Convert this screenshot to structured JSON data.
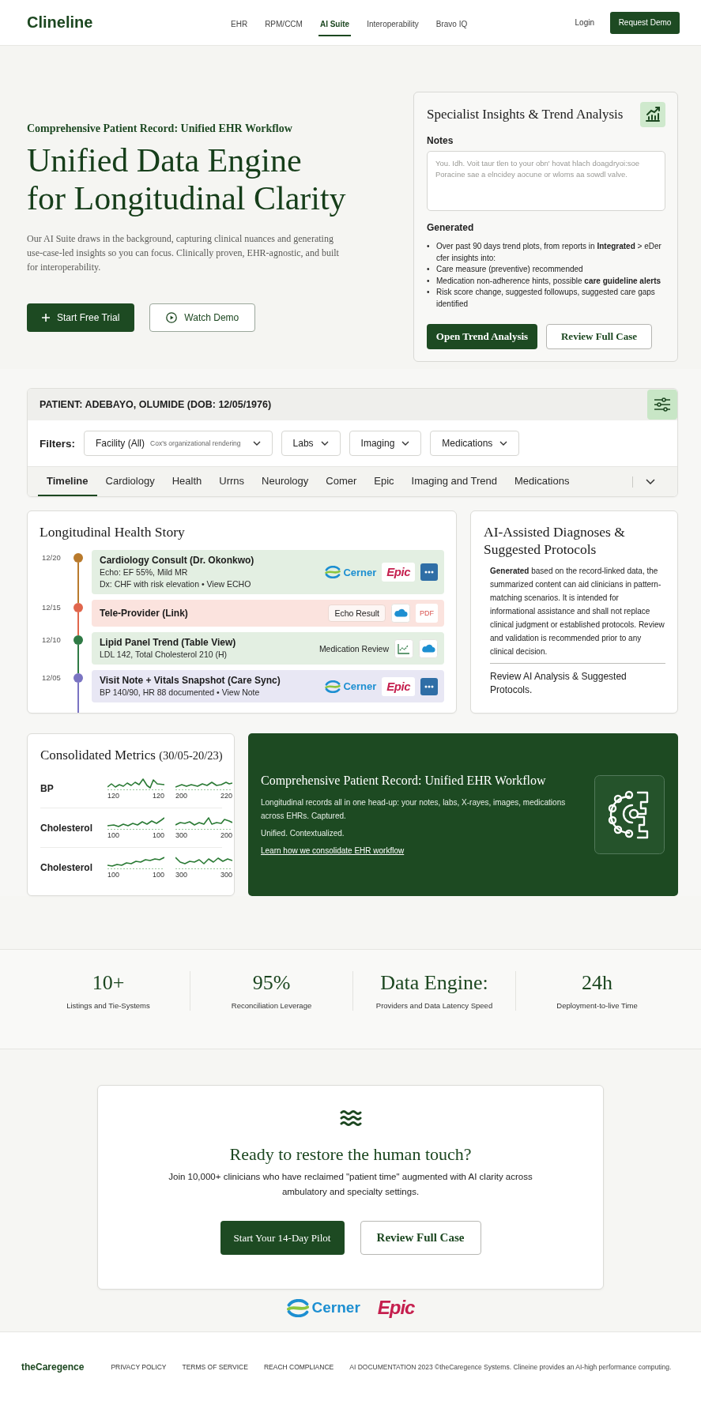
{
  "header": {
    "logo": "Clineline",
    "nav": [
      {
        "label": "EHR",
        "selected": false
      },
      {
        "label": "RPM/CCM",
        "selected": false
      },
      {
        "label": "AI Suite",
        "selected": true
      },
      {
        "label": "Interoperability",
        "selected": false
      },
      {
        "label": "Bravo IQ",
        "selected": false
      }
    ],
    "login": "Login",
    "request_demo": "Request Demo"
  },
  "hero": {
    "eyebrow": "Comprehensive Patient Record: Unified EHR Workflow",
    "headline_lines": [
      "Unified Data Engine",
      "for Longitudinal Clarity"
    ],
    "description": "Our AI Suite draws in the background, capturing clinical nuances and generating use-case-led insights so you can focus. Clinically proven, EHR-agnostic, and built for interoperability.",
    "buttons": [
      {
        "label": "Start Free Trial",
        "kind": "primary"
      },
      {
        "label": "Watch Demo",
        "kind": "secondary"
      }
    ]
  },
  "insights_card": {
    "title": "Specialist Insights & Trend Analysis",
    "notes": {
      "label": "Notes",
      "placeholder": "You. Idh. Voit taur tlen to your obn' hovat hlach doagdryoi:soe Poracine sae a elncidey aocune or wloms aa sowdl valve."
    },
    "generated_label": "Generated",
    "bullets": [
      {
        "marker": "•",
        "text": "Over past 90 days trend plots, from reports in **Integrated** > eDer cfer insights into:"
      },
      {
        "marker": "•",
        "text": "Care measure (preventive) recommended"
      },
      {
        "marker": "•",
        "text": "Medication non-adherence hints, possible **care guideline alerts**"
      },
      {
        "marker": "•",
        "text": "Risk score change, suggested followups, suggested care gaps identified"
      }
    ],
    "buttons": [
      {
        "label": "Open Trend Analysis",
        "kind": "primary"
      },
      {
        "label": "Review Full Case",
        "kind": "secondary"
      }
    ]
  },
  "patient_panel": {
    "title": "PATIENT: ADEBAYO, OLUMIDE (DOB: 12/05/1976)",
    "filters_label": "Filters:",
    "filters": [
      {
        "label": "Facility (All)",
        "note": "Cox's organizational rendering"
      },
      {
        "label": "Labs"
      },
      {
        "label": "Imaging"
      },
      {
        "label": "Medications"
      }
    ],
    "tabs": [
      {
        "label": "Timeline",
        "selected": true
      },
      {
        "label": "Cardiology",
        "selected": false
      },
      {
        "label": "Health",
        "selected": false
      },
      {
        "label": "Urrns",
        "selected": false
      },
      {
        "label": "Neurology",
        "selected": false
      },
      {
        "label": "Comer",
        "selected": false
      },
      {
        "label": "Epic",
        "selected": false
      },
      {
        "label": "Imaging and Trend",
        "selected": false
      },
      {
        "label": "Medications",
        "selected": false
      }
    ]
  },
  "timeline_card": {
    "title": "Longitudinal Health Story",
    "entries": [
      {
        "date": "12/20",
        "color": "#b97a2c",
        "card": {
          "color": "#e3efe2"
        },
        "title": "Cardiology Consult (Dr. Okonkwo)",
        "details": [
          "Echo: EF 55%, Mild MR",
          "Dx: CHF with risk elevation • View ECHO"
        ],
        "actions": [
          {
            "kind": "cerner_logo",
            "text": "Cerner"
          },
          {
            "kind": "epic_logo",
            "text": "Epic"
          },
          {
            "kind": "more_button"
          }
        ]
      },
      {
        "date": "12/15",
        "color": "#e0664c",
        "card": {
          "color": "#fbe3de"
        },
        "title": "Tele-Provider (Link)",
        "actions": [
          {
            "kind": "chip",
            "text": "Echo Result"
          },
          {
            "kind": "cloud_icon"
          },
          {
            "kind": "pdf_tag",
            "text": "PDF"
          }
        ]
      },
      {
        "date": "12/10",
        "color": "#2f7a45",
        "card": {
          "color": "#e3efe2"
        },
        "title": "Lipid Panel Trend (Table View)",
        "details": [
          "LDL 142, Total Cholesterol 210 (H)"
        ],
        "actions": [
          {
            "kind": "text",
            "text": "Medication Review"
          },
          {
            "kind": "chart_icon"
          },
          {
            "kind": "cloud_icon"
          }
        ]
      },
      {
        "date": "12/05",
        "color": "#7a74c2",
        "card": {
          "color": "#e8e7f4"
        },
        "title": "Visit Note + Vitals Snapshot (Care Sync)",
        "details": [
          "BP 140/90, HR 88 documented • View Note"
        ],
        "actions": [
          {
            "kind": "cerner_logo",
            "text": "Cerner"
          },
          {
            "kind": "epic_logo",
            "text": "Epic"
          },
          {
            "kind": "more_button"
          }
        ]
      }
    ]
  },
  "ai_card": {
    "title": "AI-Assisted Diagnoses & Suggested Protocols",
    "body": "**Generated** based on the record-linked data, the summarized content can aid clinicians in pattern-matching scenarios. It is intended for informational assistance and shall not replace clinical judgment or established protocols. Review and validation is recommended prior to any clinical decision.",
    "link": "Review AI Analysis & Suggested Protocols."
  },
  "metrics_card": {
    "title": "Consolidated Metrics",
    "period": "(30/05-20/23)",
    "rows": [
      {
        "label": "BP",
        "charts": [
          {
            "axis_labels": [
              "120",
              "120"
            ]
          },
          {
            "axis_labels": [
              "200",
              "220"
            ]
          }
        ]
      },
      {
        "label": "Cholesterol",
        "charts": [
          {
            "axis_labels": [
              "100",
              "100"
            ]
          },
          {
            "axis_labels": [
              "300",
              "200"
            ]
          }
        ]
      },
      {
        "label": "Cholesterol",
        "charts": [
          {
            "axis_labels": [
              "100",
              "100"
            ]
          },
          {
            "axis_labels": [
              "300",
              "300"
            ]
          }
        ]
      }
    ]
  },
  "workflow_card": {
    "title": "Comprehensive Patient Record: Unified EHR Workflow",
    "text": "Longitudinal records all in one head-up: your notes, labs, X-rayes, images, medications across EHRs. Captured.",
    "tagline": "Unified. Contextualized.",
    "link": "Learn how we consolidate EHR workflow"
  },
  "stats": [
    {
      "value": "10+",
      "label": "Listings and Tie-Systems"
    },
    {
      "value": "95%",
      "label": "Reconciliation Leverage"
    },
    {
      "value": "Data Engine:",
      "label": "Providers and Data Latency Speed"
    },
    {
      "value": "24h",
      "label": "Deployment-to-live Time"
    }
  ],
  "cta_card": {
    "title": "Ready to restore the human touch?",
    "text": "Join 10,000+ clinicians who have reclaimed \"patient time\" augmented with AI clarity across ambulatory and specialty settings.",
    "buttons": [
      {
        "label": "Start Your 14-Day Pilot",
        "kind": "primary"
      },
      {
        "label": "Review Full Case",
        "kind": "secondary"
      }
    ]
  },
  "partner_logos": [
    {
      "kind": "cerner",
      "name": "Cerner"
    },
    {
      "kind": "epic",
      "name": "Epic"
    }
  ],
  "footer": {
    "brand": "theCaregence",
    "links": [
      "PRIVACY POLICY",
      "TERMS OF SERVICE",
      "REACH COMPLIANCE"
    ],
    "note": "AI DOCUMENTATION 2023 ©theCaregence Systems. Clineine provides an AI-high performance computing."
  }
}
